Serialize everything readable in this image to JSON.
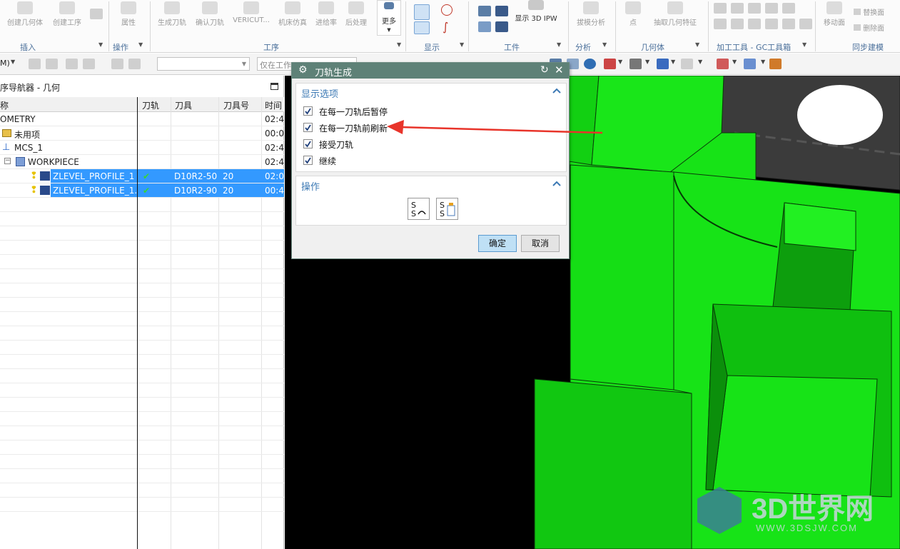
{
  "ribbon": {
    "buttons": [
      {
        "label": "创建几何体"
      },
      {
        "label": "创建工序"
      },
      {
        "label": "属性"
      },
      {
        "label": "生成刀轨"
      },
      {
        "label": "确认刀轨"
      },
      {
        "label": "VERICUT..."
      },
      {
        "label": "机床仿真"
      },
      {
        "label": "进给率"
      },
      {
        "label": "后处理"
      },
      {
        "label": "更多"
      },
      {
        "label": "显示 3D IPW"
      },
      {
        "label": "拔模分析"
      },
      {
        "label": "点"
      },
      {
        "label": "抽取几何特征"
      },
      {
        "label": "移动面"
      },
      {
        "label": "替换面"
      },
      {
        "label": "删除面"
      }
    ],
    "groups": [
      {
        "label": "插入"
      },
      {
        "label": "操作"
      },
      {
        "label": "工序"
      },
      {
        "label": "显示"
      },
      {
        "label": "工件"
      },
      {
        "label": "分析"
      },
      {
        "label": "几何体"
      },
      {
        "label": "加工工具 - GC工具箱"
      },
      {
        "label": "同步建模"
      }
    ]
  },
  "toolbar": {
    "left_select": "M)",
    "filter_placeholder": "",
    "scope_select": "仅在工作"
  },
  "navigator": {
    "title": "序导航器 - 几何",
    "columns": [
      "称",
      "刀轨",
      "刀具",
      "刀具号",
      "时间"
    ],
    "rows": [
      {
        "name": "OMETRY",
        "toolpath": "",
        "tool": "",
        "tool_no": "",
        "time": "02:4"
      },
      {
        "name": "未用项",
        "toolpath": "",
        "tool": "",
        "tool_no": "",
        "time": "00:0"
      },
      {
        "name": "MCS_1",
        "toolpath": "",
        "tool": "",
        "tool_no": "",
        "time": "02:4"
      },
      {
        "name": "WORKPIECE",
        "toolpath": "",
        "tool": "",
        "tool_no": "",
        "time": "02:4"
      },
      {
        "name": "ZLEVEL_PROFILE_1",
        "toolpath": "✔",
        "tool": "D10R2-50",
        "tool_no": "20",
        "time": "02:0"
      },
      {
        "name": "ZLEVEL_PROFILE_1...",
        "toolpath": "✔",
        "tool": "D10R2-90",
        "tool_no": "20",
        "time": "00:4"
      }
    ]
  },
  "dialog": {
    "title": "刀轨生成",
    "section_display": "显示选项",
    "options": [
      {
        "label": "在每一刀轨后暂停",
        "checked": true
      },
      {
        "label": "在每一刀轨前刷新",
        "checked": true
      },
      {
        "label": "接受刀轨",
        "checked": true
      },
      {
        "label": "继续",
        "checked": true
      }
    ],
    "section_actions": "操作",
    "ok_label": "确定",
    "cancel_label": "取消"
  },
  "watermark": {
    "brand": "3D世界网",
    "url": "WWW.3DSJW.COM"
  },
  "colors": {
    "model_green": "#17e317",
    "selection_blue": "#3399ff",
    "dialog_title": "#5e8177",
    "arrow_red": "#e8342a"
  }
}
